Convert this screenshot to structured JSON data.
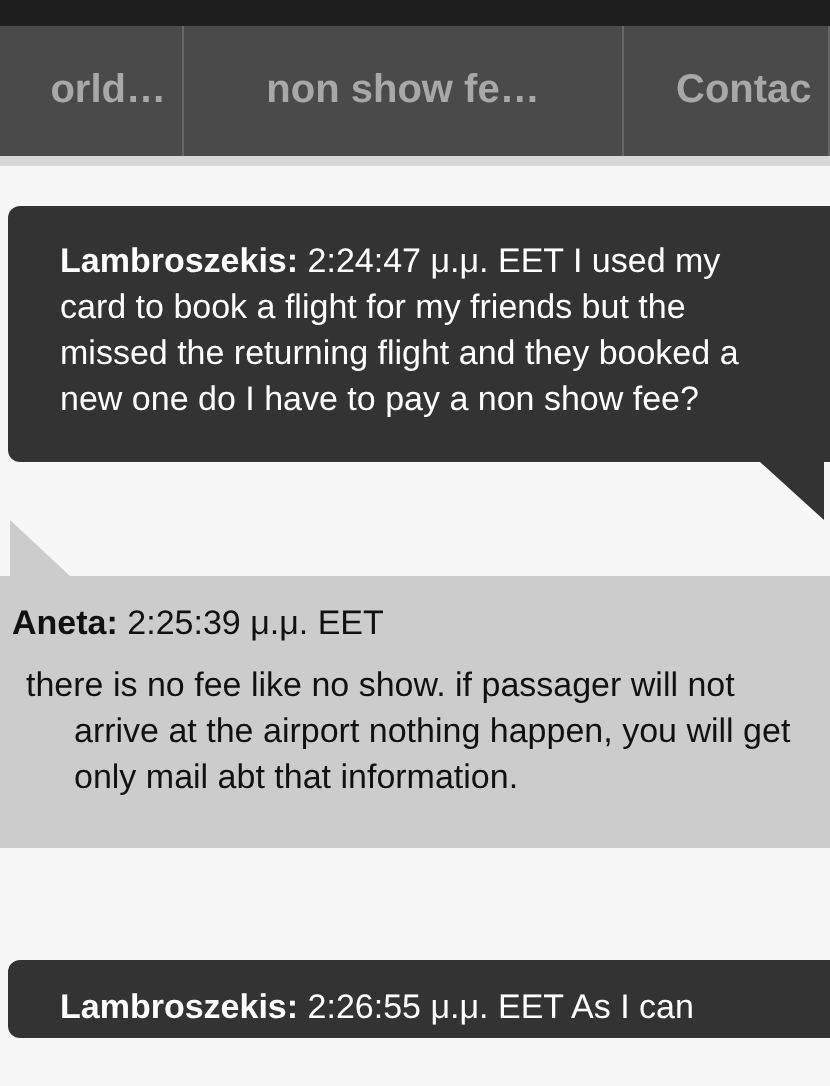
{
  "tabs": [
    {
      "label": "orld…",
      "selected": false
    },
    {
      "label": "non show fe…",
      "selected": false
    },
    {
      "label": "Contac",
      "selected": false
    }
  ],
  "messages": [
    {
      "kind": "outgoing",
      "author": "Lambroszekis:",
      "time": "2:24:47 μ.μ. EET",
      "text": "I used my card to book a flight for my friends but the missed the returning flight and they booked a new one do I have to pay a non show fee?"
    },
    {
      "kind": "incoming",
      "author": "Aneta:",
      "time": "2:25:39 μ.μ. EET",
      "text": "there is no fee like no show. if passager will not arrive at the airport nothing happen, you will get only mail abt that information."
    },
    {
      "kind": "outgoing",
      "author": "Lambroszekis:",
      "time": "2:26:55 μ.μ. EET",
      "text": "As I can"
    }
  ]
}
